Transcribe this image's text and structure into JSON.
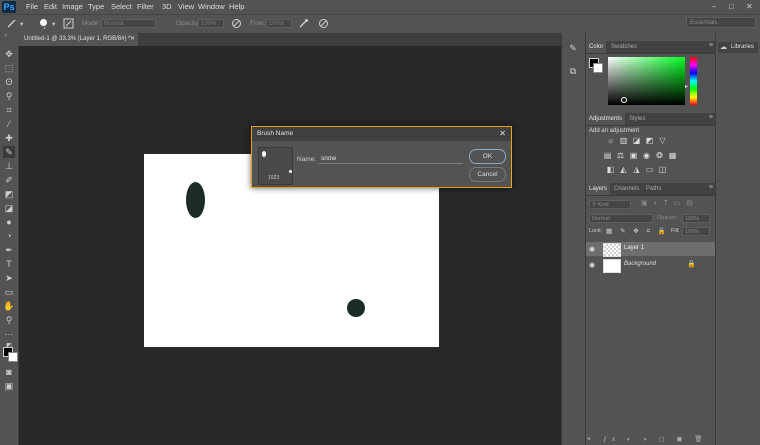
{
  "app": {
    "logo": "Ps"
  },
  "menu": [
    "File",
    "Edit",
    "Image",
    "Type",
    "Select",
    "Filter",
    "3D",
    "View",
    "Window",
    "Help"
  ],
  "window_controls": [
    "–",
    "□",
    "✕"
  ],
  "options": {
    "brush_size": "1",
    "mode_label": "Mode:",
    "mode_value": "Normal",
    "opacity_label": "Opacity:",
    "opacity_value": "100%",
    "flow_label": "Flow:",
    "flow_value": "100%",
    "workspace": "Essentials"
  },
  "document": {
    "tab_title": "Untitled-1 @ 33.3% (Layer 1, RGB/8#) *",
    "close": "✕"
  },
  "tools": [
    "move-tool",
    "marquee-tool",
    "lasso-tool",
    "quick-select-tool",
    "crop-tool",
    "eyedropper-tool",
    "healing-tool",
    "brush-tool",
    "stamp-tool",
    "history-brush-tool",
    "eraser-tool",
    "gradient-tool",
    "blur-tool",
    "dodge-tool",
    "pen-tool",
    "type-tool",
    "path-select-tool",
    "shape-tool",
    "hand-tool",
    "zoom-tool",
    "more-tool",
    "color-swatch",
    "quick-mask",
    "screen-mode"
  ],
  "color_panel": {
    "tabs": [
      "Color",
      "Swatches"
    ],
    "hue_accent": "#00ff22"
  },
  "adjustments_panel": {
    "tabs": [
      "Adjustments",
      "Styles"
    ],
    "add_label": "Add an adjustment"
  },
  "layers_panel": {
    "tabs": [
      "Layers",
      "Channels",
      "Paths"
    ],
    "search_placeholder": "Kind",
    "blend_mode": "Normal",
    "opacity_label": "Opacity:",
    "opacity_value": "100%",
    "lock_label": "Lock:",
    "fill_label": "Fill:",
    "fill_value": "100%",
    "layers": [
      {
        "name": "Layer 1",
        "selected": true
      },
      {
        "name": "Background",
        "selected": false,
        "locked": true
      }
    ]
  },
  "libraries": {
    "label": "Libraries"
  },
  "dialog": {
    "title": "Brush Name",
    "close": "✕",
    "name_label": "Name:",
    "name_value": "snow",
    "brush_size_value": "1023",
    "ok_label": "OK",
    "cancel_label": "Cancel",
    "accent": "#f0a31e"
  }
}
